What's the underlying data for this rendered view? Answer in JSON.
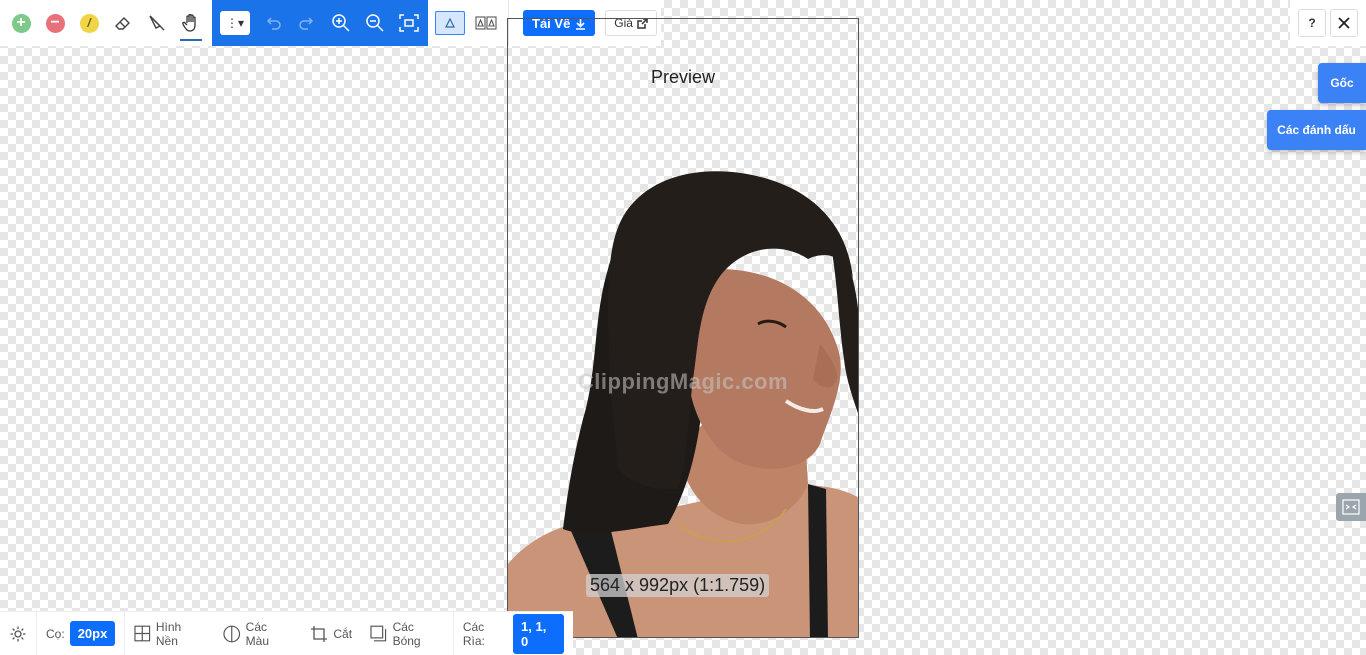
{
  "toolbar": {
    "tools": [
      {
        "name": "add-icon"
      },
      {
        "name": "remove-icon"
      },
      {
        "name": "hair-icon"
      },
      {
        "name": "eraser-icon"
      },
      {
        "name": "scalpel-icon"
      },
      {
        "name": "hand-icon"
      }
    ],
    "menu_caret": "▾",
    "download_label": "Tải Về",
    "price_label": "Giá"
  },
  "top_right": {
    "help_label": "?"
  },
  "side_tabs": {
    "original_label": "Gốc",
    "marks_label": "Các đánh dấu"
  },
  "preview": {
    "title": "Preview",
    "watermark": "ClippingMagic.com",
    "dimensions": "564 x 992px (1:1.759)"
  },
  "bottombar": {
    "brush_label": "Cọ:",
    "brush_size": "20px",
    "background_label": "Hình Nền",
    "colors_label": "Các Màu",
    "crop_label": "Cắt",
    "shadows_label": "Các Bóng",
    "edges_label": "Các Rìa:",
    "edges_value": "1, 1, 0"
  },
  "colors": {
    "accent": "#0d6efd",
    "toolbar_blue": "#1a73e8",
    "side_tab": "#3b82f6",
    "add_green": "#7cc98a",
    "remove_red": "#e8707a",
    "hair_yellow": "#f2d547"
  }
}
